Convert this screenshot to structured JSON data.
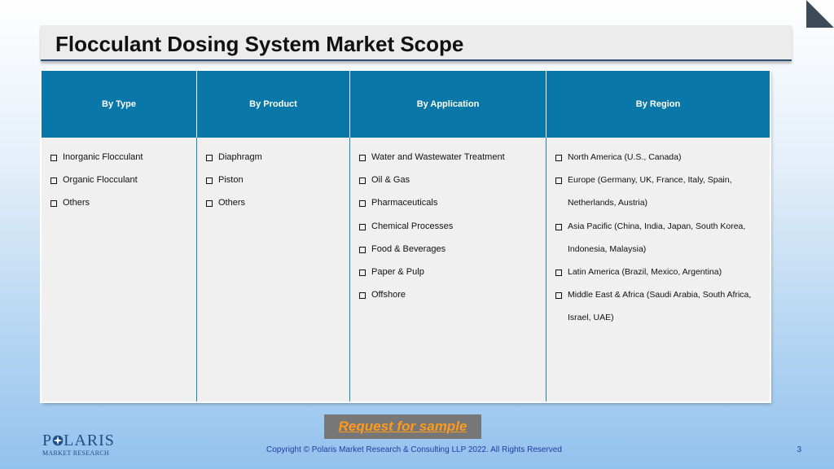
{
  "slide": {
    "title": "Flocculant Dosing System Market Scope",
    "page_number": "3",
    "copyright": "Copyright © Polaris Market Research & Consulting LLP 2022. All Rights Reserved",
    "request_button": "Request for sample"
  },
  "logo": {
    "line1_a": "P",
    "line1_b": "LARIS",
    "line2": "MARKET RESEARCH"
  },
  "table": {
    "columns": [
      {
        "header": "By Type",
        "items": [
          "Inorganic Flocculant",
          "Organic Flocculant",
          "Others"
        ]
      },
      {
        "header": "By Product",
        "items": [
          "Diaphragm",
          "Piston",
          "Others"
        ]
      },
      {
        "header": "By Application",
        "items": [
          "Water and Wastewater Treatment",
          "Oil & Gas",
          "Pharmaceuticals",
          "Chemical Processes",
          "Food & Beverages",
          "Paper & Pulp",
          "Offshore"
        ]
      },
      {
        "header": "By Region",
        "items": [
          {
            "line1": "North America (U.S., Canada)",
            "line2": ""
          },
          {
            "line1": "Europe (Germany, UK, France, Italy, Spain,",
            "line2": "Netherlands, Austria)"
          },
          {
            "line1": "Asia Pacific (China, India, Japan, South Korea,",
            "line2": "Indonesia, Malaysia)"
          },
          {
            "line1": "Latin America (Brazil, Mexico, Argentina)",
            "line2": ""
          },
          {
            "line1": "Middle East & Africa (Saudi Arabia, South Africa,",
            "line2": "Israel, UAE)"
          }
        ]
      }
    ]
  },
  "colors": {
    "header_bg": "#0978a9",
    "table_bg": "#f0f0f0",
    "button_bg": "#777777",
    "button_text": "#ff9a1a",
    "logo": "#1f4d86"
  },
  "icons": [
    "checkbox-bullet-icon",
    "polaris-star-icon",
    "corner-fold-icon"
  ]
}
